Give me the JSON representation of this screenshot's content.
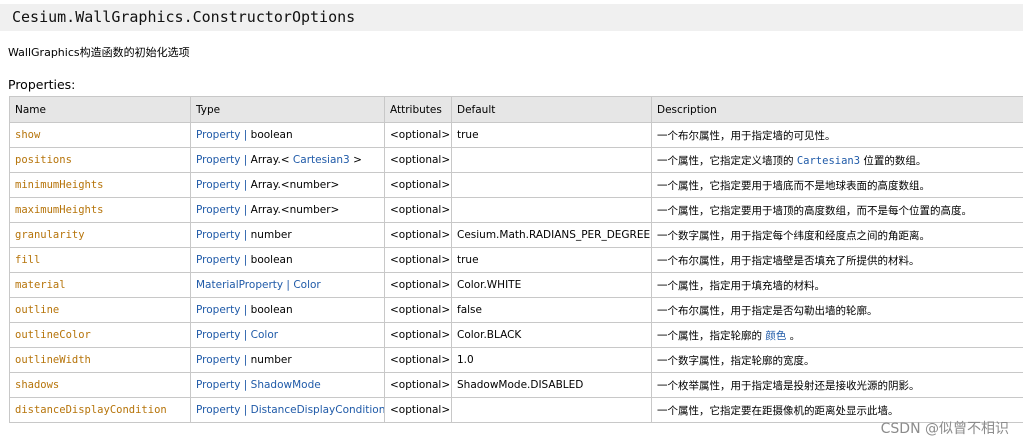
{
  "title": "Cesium.WallGraphics.ConstructorOptions",
  "description": "WallGraphics构造函数的初始化选项",
  "properties_heading": "Properties:",
  "headers": [
    "Name",
    "Type",
    "Attributes",
    "Default",
    "Description"
  ],
  "rows": [
    {
      "name": "show",
      "type_link": "Property",
      "sep": " | ",
      "type_rest": "boolean",
      "type_link2": "",
      "type_tail": "",
      "attr": "<optional>",
      "default": "true",
      "desc_pre": "一个布尔属性，用于指定墙的可见性。",
      "desc_code": "",
      "desc_post": ""
    },
    {
      "name": "positions",
      "type_link": "Property",
      "sep": " | ",
      "type_rest": "Array.< ",
      "type_link2": "Cartesian3",
      "type_tail": " >",
      "attr": "<optional>",
      "default": "",
      "desc_pre": "一个属性，它指定定义墙顶的 ",
      "desc_code": "Cartesian3",
      "desc_post": "  位置的数组。"
    },
    {
      "name": "minimumHeights",
      "type_link": "Property",
      "sep": " | ",
      "type_rest": "Array.<number>",
      "type_link2": "",
      "type_tail": "",
      "attr": "<optional>",
      "default": "",
      "desc_pre": "一个属性，它指定要用于墙底而不是地球表面的高度数组。",
      "desc_code": "",
      "desc_post": ""
    },
    {
      "name": "maximumHeights",
      "type_link": "Property",
      "sep": " | ",
      "type_rest": "Array.<number>",
      "type_link2": "",
      "type_tail": "",
      "attr": "<optional>",
      "default": "",
      "desc_pre": "一个属性，它指定要用于墙顶的高度数组，而不是每个位置的高度。",
      "desc_code": "",
      "desc_post": ""
    },
    {
      "name": "granularity",
      "type_link": "Property",
      "sep": " | ",
      "type_rest": "number",
      "type_link2": "",
      "type_tail": "",
      "attr": "<optional>",
      "default": "Cesium.Math.RADIANS_PER_DEGREE",
      "desc_pre": "一个数字属性，用于指定每个纬度和经度点之间的角距离。",
      "desc_code": "",
      "desc_post": ""
    },
    {
      "name": "fill",
      "type_link": "Property",
      "sep": " | ",
      "type_rest": "boolean",
      "type_link2": "",
      "type_tail": "",
      "attr": "<optional>",
      "default": "true",
      "desc_pre": "一个布尔属性，用于指定墙壁是否填充了所提供的材料。",
      "desc_code": "",
      "desc_post": ""
    },
    {
      "name": "material",
      "type_link": "MaterialProperty",
      "sep": " | ",
      "type_rest": "",
      "type_link2": "Color",
      "type_tail": "",
      "attr": "<optional>",
      "default": "Color.WHITE",
      "desc_pre": "一个属性，指定用于填充墙的材料。",
      "desc_code": "",
      "desc_post": ""
    },
    {
      "name": "outline",
      "type_link": "Property",
      "sep": " | ",
      "type_rest": "boolean",
      "type_link2": "",
      "type_tail": "",
      "attr": "<optional>",
      "default": "false",
      "desc_pre": "一个布尔属性，用于指定是否勾勒出墙的轮廓。",
      "desc_code": "",
      "desc_post": ""
    },
    {
      "name": "outlineColor",
      "type_link": "Property",
      "sep": " | ",
      "type_rest": "",
      "type_link2": "Color",
      "type_tail": "",
      "attr": "<optional>",
      "default": "Color.BLACK",
      "desc_pre": "一个属性，指定轮廓的 ",
      "desc_code": "颜色",
      "desc_post": "  。"
    },
    {
      "name": "outlineWidth",
      "type_link": "Property",
      "sep": " | ",
      "type_rest": "number",
      "type_link2": "",
      "type_tail": "",
      "attr": "<optional>",
      "default": "1.0",
      "desc_pre": "一个数字属性，指定轮廓的宽度。",
      "desc_code": "",
      "desc_post": ""
    },
    {
      "name": "shadows",
      "type_link": "Property",
      "sep": " | ",
      "type_rest": "",
      "type_link2": "ShadowMode",
      "type_tail": "",
      "attr": "<optional>",
      "default": "ShadowMode.DISABLED",
      "desc_pre": "一个枚举属性，用于指定墙是投射还是接收光源的阴影。",
      "desc_code": "",
      "desc_post": ""
    },
    {
      "name": "distanceDisplayCondition",
      "type_link": "Property",
      "sep": " | ",
      "type_rest": "",
      "type_link2": "DistanceDisplayCondition",
      "type_tail": "",
      "attr": "<optional>",
      "default": "",
      "desc_pre": "一个属性，它指定要在距摄像机的距离处显示此墙。",
      "desc_code": "",
      "desc_post": ""
    }
  ],
  "watermark": "CSDN @似曾不相识"
}
